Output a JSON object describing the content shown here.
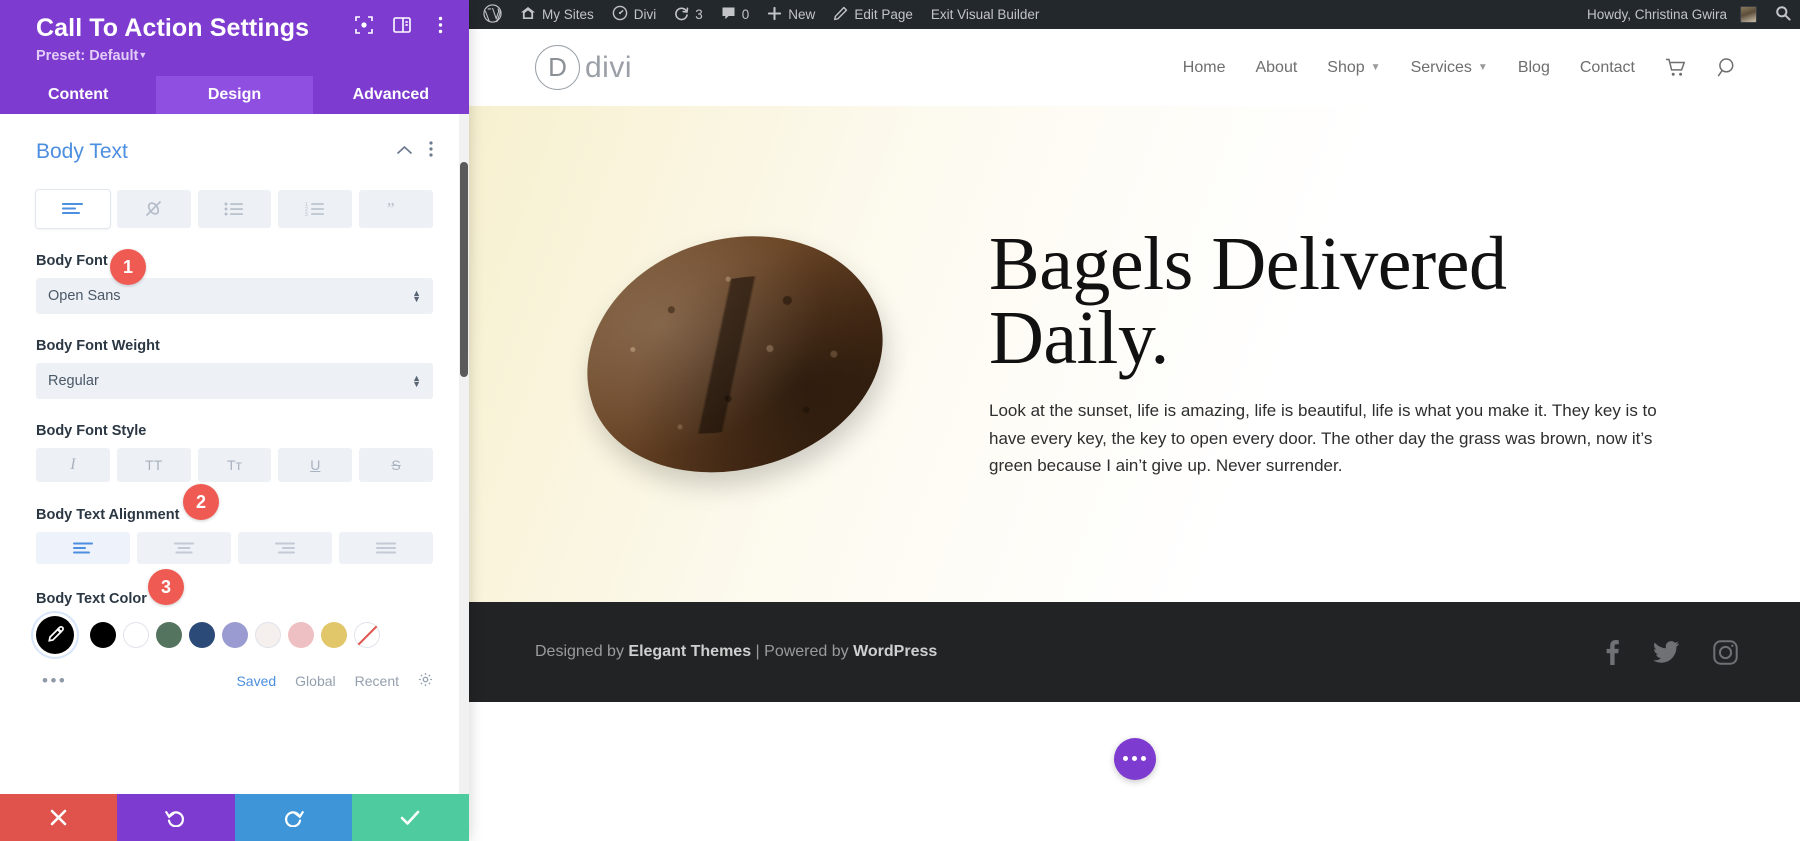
{
  "panel": {
    "title": "Call To Action Settings",
    "preset_label": "Preset: Default",
    "header_icons": [
      "focus-frame-icon",
      "layout-panel-icon",
      "kebab-menu-icon"
    ],
    "tabs": [
      {
        "label": "Content",
        "active": false
      },
      {
        "label": "Design",
        "active": true
      },
      {
        "label": "Advanced",
        "active": false
      }
    ],
    "section": {
      "title": "Body Text",
      "collapse_icon": "chevron-up-icon",
      "more_icon": "kebab-menu-icon",
      "text_type_buttons": [
        {
          "name": "paragraph",
          "icon": "paragraph-lines-icon",
          "active": true
        },
        {
          "name": "link",
          "icon": "link-slash-icon",
          "active": false
        },
        {
          "name": "unordered-list",
          "icon": "bullet-list-icon",
          "active": false
        },
        {
          "name": "ordered-list",
          "icon": "numbered-list-icon",
          "active": false
        },
        {
          "name": "blockquote",
          "icon": "quote-icon",
          "active": false
        }
      ],
      "fields": [
        {
          "label": "Body Font",
          "value": "Open Sans",
          "badge": "1"
        },
        {
          "label": "Body Font Weight",
          "value": "Regular",
          "badge": null
        }
      ],
      "font_style": {
        "label": "Body Font Style",
        "options": [
          {
            "name": "italic",
            "glyph": "I"
          },
          {
            "name": "uppercase",
            "glyph": "TT"
          },
          {
            "name": "small-caps",
            "glyph": "Tᴛ"
          },
          {
            "name": "underline",
            "glyph": "U"
          },
          {
            "name": "strikethrough",
            "glyph": "S"
          }
        ]
      },
      "alignment": {
        "label": "Body Text Alignment",
        "badge": "2",
        "options": [
          {
            "name": "align-left",
            "active": true
          },
          {
            "name": "align-center",
            "active": false
          },
          {
            "name": "align-right",
            "active": false
          },
          {
            "name": "align-justify",
            "active": false
          }
        ]
      },
      "color": {
        "label": "Body Text Color",
        "badge": "3",
        "picker_icon": "eyedropper-icon",
        "picker_color": "#000000",
        "swatches": [
          {
            "name": "black",
            "hex": "#000000"
          },
          {
            "name": "white",
            "hex": "#ffffff"
          },
          {
            "name": "green",
            "hex": "#55745f"
          },
          {
            "name": "navy",
            "hex": "#2c4a77"
          },
          {
            "name": "periwinkle",
            "hex": "#9a9bd0"
          },
          {
            "name": "off-white",
            "hex": "#f5f0ee"
          },
          {
            "name": "pink",
            "hex": "#eec0c4"
          },
          {
            "name": "gold",
            "hex": "#e2c76a"
          },
          {
            "name": "none",
            "hex": "transparent"
          }
        ],
        "more_label": "•••",
        "tabs": [
          {
            "label": "Saved",
            "active": true
          },
          {
            "label": "Global",
            "active": false
          },
          {
            "label": "Recent",
            "active": false
          }
        ],
        "settings_icon": "gear-icon"
      }
    },
    "footer_buttons": [
      {
        "name": "cancel",
        "icon": "close-x-icon",
        "color": "#e0534d"
      },
      {
        "name": "undo",
        "icon": "undo-arrow-icon",
        "color": "#7e3bd0"
      },
      {
        "name": "redo",
        "icon": "redo-arrow-icon",
        "color": "#3e96d9"
      },
      {
        "name": "save",
        "icon": "checkmark-icon",
        "color": "#4ecca0"
      }
    ]
  },
  "adminbar": {
    "items": [
      {
        "name": "wordpress-logo",
        "label": "",
        "icon": "wordpress-icon"
      },
      {
        "name": "my-sites",
        "label": "My Sites",
        "icon": "sites-house-icon"
      },
      {
        "name": "divi",
        "label": "Divi",
        "icon": "divi-gauge-icon"
      },
      {
        "name": "updates",
        "label": "3",
        "icon": "update-circle-icon"
      },
      {
        "name": "comments",
        "label": "0",
        "icon": "comment-bubble-icon"
      },
      {
        "name": "new",
        "label": "New",
        "icon": "plus-icon"
      },
      {
        "name": "edit-page",
        "label": "Edit Page",
        "icon": "pencil-icon"
      },
      {
        "name": "exit-visual-builder",
        "label": "Exit Visual Builder",
        "icon": ""
      }
    ],
    "greeting": "Howdy, Christina Gwira",
    "search_icon": "search-icon"
  },
  "site": {
    "logo": {
      "mark": "D",
      "text": "divi"
    },
    "nav": [
      {
        "label": "Home",
        "has_dropdown": false
      },
      {
        "label": "About",
        "has_dropdown": false
      },
      {
        "label": "Shop",
        "has_dropdown": true
      },
      {
        "label": "Services",
        "has_dropdown": true
      },
      {
        "label": "Blog",
        "has_dropdown": false
      },
      {
        "label": "Contact",
        "has_dropdown": false
      }
    ],
    "nav_icons": [
      {
        "name": "cart-icon"
      },
      {
        "name": "search-icon"
      }
    ],
    "hero": {
      "image_alt": "bread-loaf-image",
      "title": "Bagels Delivered Daily.",
      "body": "Look at the sunset, life is amazing, life is beautiful, life is what you make it. They key is to have every key, the key to open every door. The other day the grass was brown, now it’s green because I ain’t give up. Never surrender."
    },
    "footer": {
      "text_prefix": "Designed by ",
      "brand1": "Elegant Themes",
      "separator": " | ",
      "text_middle": "Powered by ",
      "brand2": "WordPress",
      "social": [
        "facebook-icon",
        "twitter-icon",
        "instagram-icon"
      ]
    },
    "fab": {
      "name": "divi-menu-fab",
      "icon": "ellipsis-icon"
    }
  }
}
